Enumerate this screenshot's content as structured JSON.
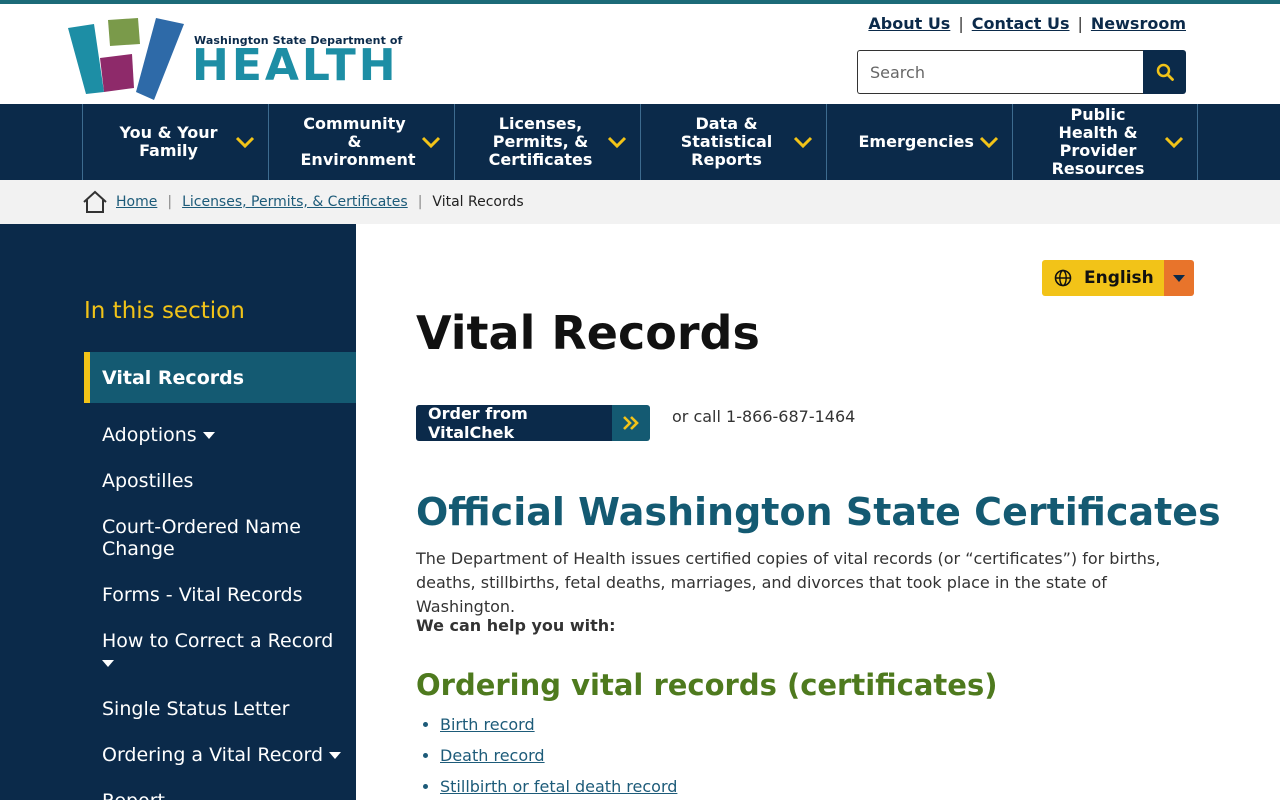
{
  "brand": {
    "dept_line": "Washington State Department of",
    "name": "HEALTH",
    "colors": {
      "teal": "#1d8ea5",
      "navy": "#0b2a4a",
      "gold": "#f2c318",
      "orange": "#e8742b",
      "green": "#4e7a1e"
    }
  },
  "utility_nav": [
    {
      "label": "About Us"
    },
    {
      "label": "Contact Us"
    },
    {
      "label": "Newsroom"
    }
  ],
  "search": {
    "placeholder": "Search",
    "icon": "search-icon"
  },
  "main_nav": [
    {
      "label": "You & Your Family"
    },
    {
      "label": "Community & Environment"
    },
    {
      "label": "Licenses, Permits, & Certificates"
    },
    {
      "label": "Data & Statistical Reports"
    },
    {
      "label": "Emergencies"
    },
    {
      "label": "Public Health & Provider Resources"
    }
  ],
  "breadcrumb": {
    "items": [
      {
        "label": "Home"
      },
      {
        "label": "Licenses, Permits, & Certificates"
      },
      {
        "label": "Vital Records"
      }
    ]
  },
  "sidebar": {
    "title": "In this section",
    "current": "Vital Records",
    "items": [
      {
        "label": "Adoptions",
        "has_dropdown": true
      },
      {
        "label": "Apostilles",
        "has_dropdown": false
      },
      {
        "label": "Court-Ordered Name Change",
        "has_dropdown": false
      },
      {
        "label": "Forms - Vital Records",
        "has_dropdown": false
      },
      {
        "label": "How to Correct a Record",
        "has_dropdown": true
      },
      {
        "label": "Single Status Letter",
        "has_dropdown": false
      },
      {
        "label": "Ordering a Vital Record",
        "has_dropdown": true
      },
      {
        "label": "Report",
        "has_dropdown": false
      }
    ]
  },
  "language": {
    "label": "English",
    "icon": "globe-icon"
  },
  "page": {
    "title": "Vital Records",
    "order_button": "Order from VitalChek",
    "call_text": "or call 1-866-687-1464",
    "section_heading": "Official Washington State Certificates",
    "intro": "The Department of Health issues certified copies of vital records (or “certificates”) for births, deaths, stillbirths, fetal deaths, marriages, and divorces that took place in the state of Washington.",
    "help_label": "We can help you with:",
    "subheading": "Ordering vital records (certificates)",
    "links": [
      {
        "label": "Birth record"
      },
      {
        "label": "Death record"
      },
      {
        "label": "Stillbirth or fetal death record"
      }
    ]
  }
}
